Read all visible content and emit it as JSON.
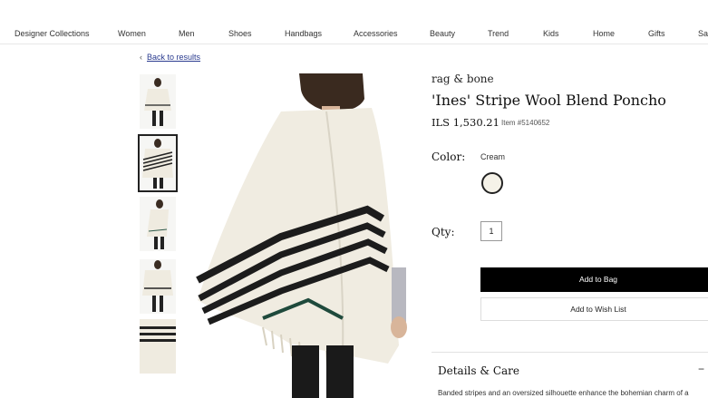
{
  "nav": {
    "items": [
      "Designer Collections",
      "Women",
      "Men",
      "Shoes",
      "Handbags",
      "Accessories",
      "Beauty",
      "Trend",
      "Kids",
      "Home",
      "Gifts",
      "Sa"
    ]
  },
  "breadcrumb": {
    "back_label": "Back to results"
  },
  "product": {
    "brand": "rag & bone",
    "title": "'Ines' Stripe Wool Blend Poncho",
    "price": "ILS 1,530.21",
    "item_number": "Item #5140652"
  },
  "color": {
    "label": "Color:",
    "selected": "Cream",
    "swatch_hex": "#f5f2e8"
  },
  "quantity": {
    "label": "Qty:",
    "value": "1"
  },
  "actions": {
    "add_to_bag": "Add to Bag",
    "add_to_wish_list": "Add to Wish List"
  },
  "details": {
    "heading": "Details & Care",
    "toggle_icon": "−",
    "description": "Banded stripes and an oversized silhouette enhance the bohemian charm of a"
  },
  "icons": {
    "back": "chevron-left-icon"
  }
}
